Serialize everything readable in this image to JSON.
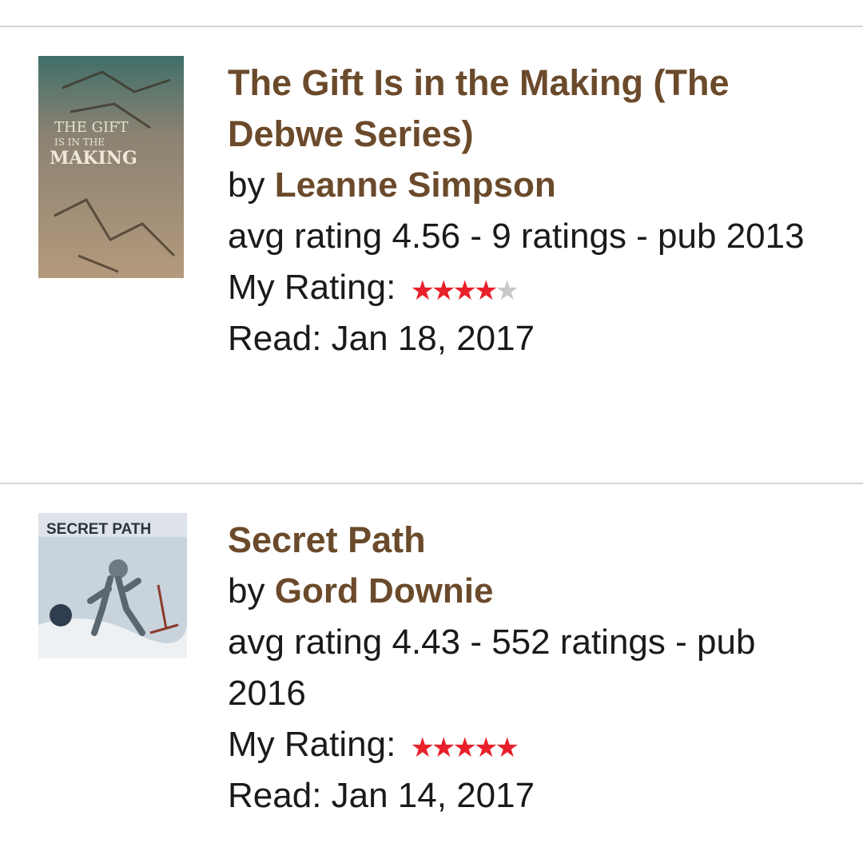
{
  "books": [
    {
      "title": "The Gift Is in the Making (The Debwe Series)",
      "by": "by",
      "author": "Leanne Simpson",
      "stats": "avg rating 4.56 - 9 ratings - pub 2013",
      "my_rating_label": "My Rating:",
      "my_rating": 4,
      "read": "Read: Jan 18, 2017",
      "cover_text": [
        "THE GIFT",
        "IS IN THE",
        "MAKING"
      ]
    },
    {
      "title": "Secret Path",
      "by": "by",
      "author": "Gord Downie",
      "stats": "avg rating 4.43 - 552 ratings - pub 2016",
      "my_rating_label": "My Rating:",
      "my_rating": 5,
      "read": "Read: Jan 14, 2017",
      "cover_text": [
        "SECRET PATH"
      ]
    }
  ],
  "colors": {
    "link": "#6b4a2b",
    "star_on": "#e8202a",
    "star_off": "#c9c9c9"
  },
  "icons": {
    "star": "star-icon"
  }
}
